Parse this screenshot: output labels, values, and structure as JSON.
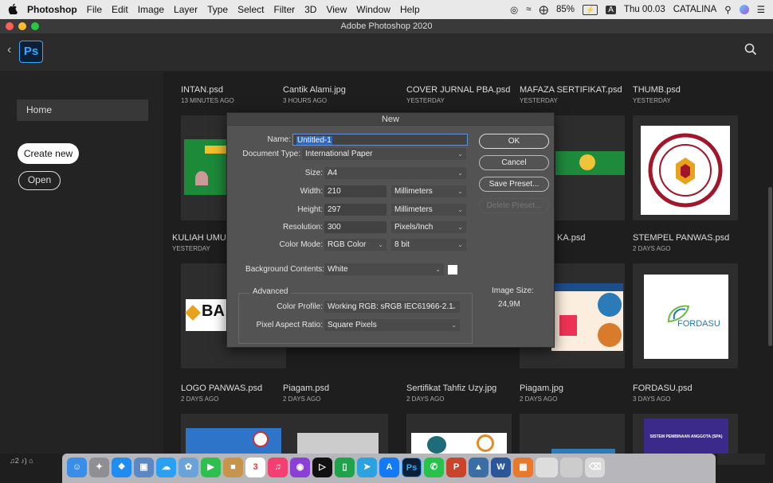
{
  "menubar": {
    "app": "Photoshop",
    "items": [
      "File",
      "Edit",
      "Image",
      "Layer",
      "Type",
      "Select",
      "Filter",
      "3D",
      "View",
      "Window",
      "Help"
    ],
    "battery": "85%",
    "input": "A",
    "clock": "Thu 00.03",
    "user": "CATALINA"
  },
  "window": {
    "title": "Adobe Photoshop 2020"
  },
  "app": {
    "logo": "Ps"
  },
  "sidebar": {
    "home": "Home",
    "create": "Create new",
    "open": "Open"
  },
  "files": [
    {
      "name": "INTAN.psd",
      "date": "13 MINUTES AGO"
    },
    {
      "name": "Cantik Alami.jpg",
      "date": "3 HOURS AGO"
    },
    {
      "name": "COVER JURNAL PBA.psd",
      "date": "YESTERDAY"
    },
    {
      "name": "MAFAZA SERTIFIKAT.psd",
      "date": "YESTERDAY"
    },
    {
      "name": "THUMB.psd",
      "date": "YESTERDAY"
    },
    {
      "name": "KULIAH UMUM",
      "date": "YESTERDAY"
    },
    {
      "name": "KA.psd",
      "date": ""
    },
    {
      "name": "STEMPEL PANWAS.psd",
      "date": "2 DAYS AGO"
    },
    {
      "name": "LOGO PANWAS.psd",
      "date": "2 DAYS AGO"
    },
    {
      "name": "Piagam.psd",
      "date": "2 DAYS AGO"
    },
    {
      "name": "Sertifikat Tahfiz Uzy.jpg",
      "date": "2 DAYS AGO"
    },
    {
      "name": "Piagam.jpg",
      "date": "2 DAYS AGO"
    },
    {
      "name": "FORDASU.psd",
      "date": "3 DAYS AGO"
    }
  ],
  "thumbs": {
    "fordasu": "FORDASU",
    "spa": "SISTEM PEMBINAAN ANGGOTA (SPA)",
    "ba": "BA"
  },
  "dialog": {
    "title": "New",
    "name_label": "Name:",
    "name_value": "Untitled-1",
    "doctype_label": "Document Type:",
    "doctype_value": "International Paper",
    "size_label": "Size:",
    "size_value": "A4",
    "width_label": "Width:",
    "width_value": "210",
    "width_unit": "Millimeters",
    "height_label": "Height:",
    "height_value": "297",
    "height_unit": "Millimeters",
    "res_label": "Resolution:",
    "res_value": "300",
    "res_unit": "Pixels/Inch",
    "colormode_label": "Color Mode:",
    "colormode_value": "RGB Color",
    "bitdepth": "8 bit",
    "bg_label": "Background Contents:",
    "bg_value": "White",
    "advanced": "Advanced",
    "profile_label": "Color Profile:",
    "profile_value": "Working RGB:  sRGB IEC61966-2.1",
    "aspect_label": "Pixel Aspect Ratio:",
    "aspect_value": "Square Pixels",
    "imgsize_label": "Image Size:",
    "imgsize_value": "24,9M",
    "ok": "OK",
    "cancel": "Cancel",
    "save_preset": "Save Preset...",
    "delete_preset": "Delete Preset..."
  },
  "dock": {
    "badges": {
      "calendar_day": "3",
      "photoshop": "Ps"
    }
  },
  "colors": {
    "accent": "#31a8ff",
    "dialog_bg": "#535353",
    "highlight": "#2a67c6"
  }
}
